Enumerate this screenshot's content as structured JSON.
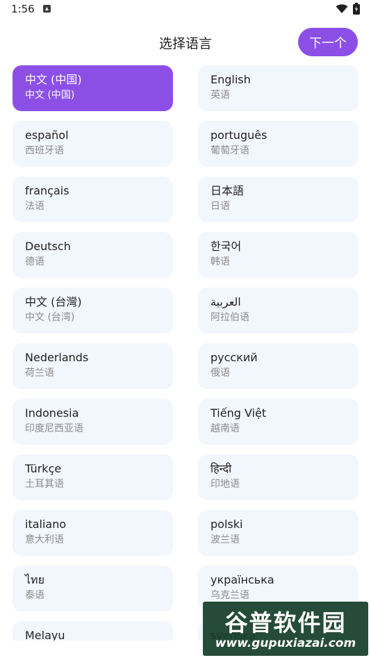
{
  "status_bar": {
    "time": "1:56",
    "icons": [
      "app-notification-icon",
      "wifi-icon",
      "battery-icon"
    ]
  },
  "header": {
    "title": "选择语言",
    "next_label": "下一个"
  },
  "colors": {
    "accent": "#8c4fe6",
    "card_background": "#f2f6fd",
    "primary_text": "#222222",
    "secondary_text": "#8b8b8b"
  },
  "languages": [
    {
      "native": "中文 (中国)",
      "translated": "中文 (中国)",
      "selected": true
    },
    {
      "native": "English",
      "translated": "英语",
      "selected": false
    },
    {
      "native": "español",
      "translated": "西班牙语",
      "selected": false
    },
    {
      "native": "português",
      "translated": "葡萄牙语",
      "selected": false
    },
    {
      "native": "français",
      "translated": "法语",
      "selected": false
    },
    {
      "native": "日本語",
      "translated": "日语",
      "selected": false
    },
    {
      "native": "Deutsch",
      "translated": "德语",
      "selected": false
    },
    {
      "native": "한국어",
      "translated": "韩语",
      "selected": false
    },
    {
      "native": "中文 (台灣)",
      "translated": "中文 (台湾)",
      "selected": false
    },
    {
      "native": "العربية",
      "translated": "阿拉伯语",
      "selected": false
    },
    {
      "native": "Nederlands",
      "translated": "荷兰语",
      "selected": false
    },
    {
      "native": "русский",
      "translated": "俄语",
      "selected": false
    },
    {
      "native": "Indonesia",
      "translated": "印度尼西亚语",
      "selected": false
    },
    {
      "native": "Tiếng Việt",
      "translated": "越南语",
      "selected": false
    },
    {
      "native": "Türkçe",
      "translated": "土耳其语",
      "selected": false
    },
    {
      "native": "हिन्दी",
      "translated": "印地语",
      "selected": false
    },
    {
      "native": "italiano",
      "translated": "意大利语",
      "selected": false
    },
    {
      "native": "polski",
      "translated": "波兰语",
      "selected": false
    },
    {
      "native": "ไทย",
      "translated": "泰语",
      "selected": false
    },
    {
      "native": "українська",
      "translated": "乌克兰语",
      "selected": false
    },
    {
      "native": "Melayu",
      "translated": "",
      "selected": false
    },
    {
      "native": "svenska",
      "translated": "",
      "selected": false
    }
  ],
  "watermark": {
    "title": "谷普软件园",
    "url": "www.gupuxiazai.com"
  }
}
